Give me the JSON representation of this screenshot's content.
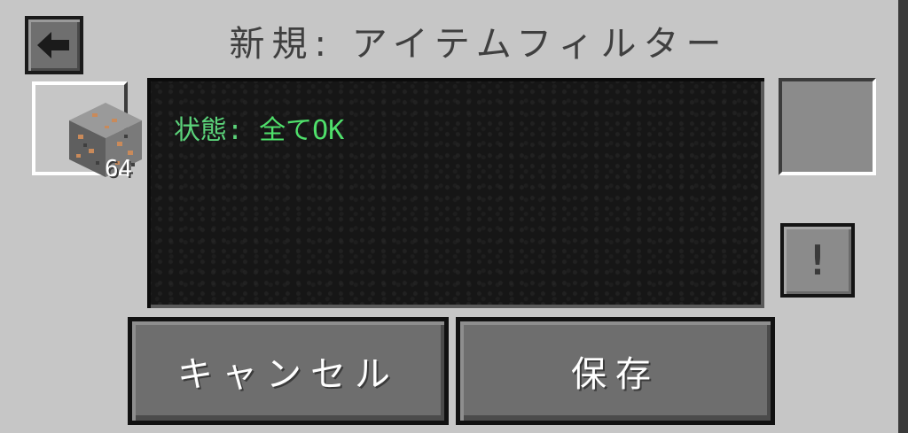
{
  "header": {
    "back_icon": "arrow-left-icon",
    "title": "新規: アイテムフィルター"
  },
  "item_slot": {
    "item_icon": "iron-ore-block-icon",
    "count": "64"
  },
  "status": {
    "label": "状態:",
    "value": "全てOK"
  },
  "warning_button": {
    "glyph": "!"
  },
  "buttons": {
    "cancel_label": "キャンセル",
    "save_label": "保存"
  },
  "colors": {
    "panel_bg": "#c6c6c6",
    "screen_bg": "#161616",
    "status_text": "#4fe06b",
    "button_bg": "#6e6e6e"
  }
}
